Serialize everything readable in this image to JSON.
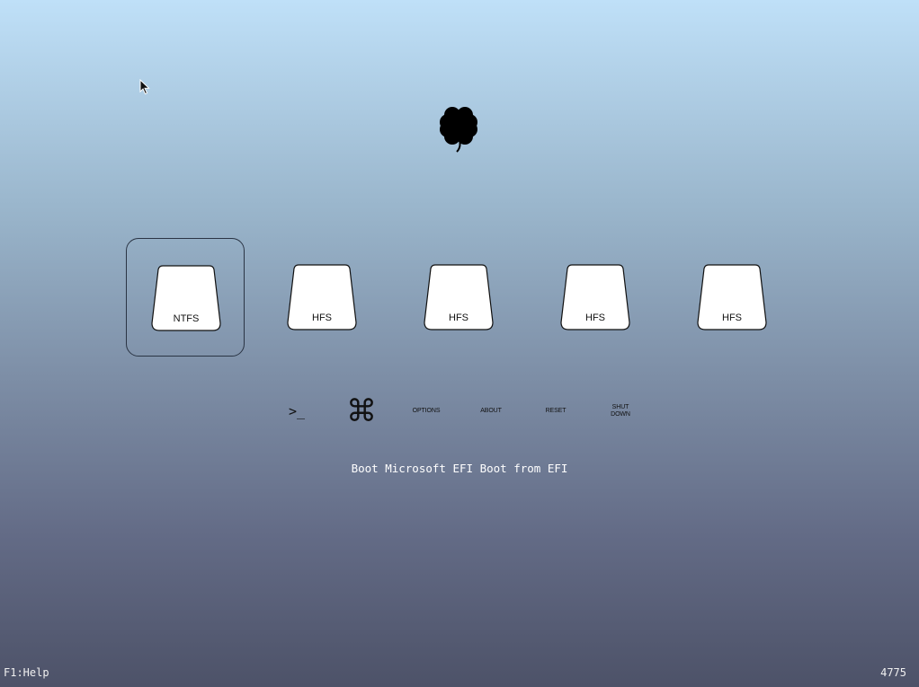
{
  "boot_menu": {
    "logo_icon": "clover-icon",
    "volumes": [
      {
        "label": "NTFS",
        "selected": true
      },
      {
        "label": "HFS",
        "selected": false
      },
      {
        "label": "HFS",
        "selected": false
      },
      {
        "label": "HFS",
        "selected": false
      },
      {
        "label": "HFS",
        "selected": false
      }
    ],
    "tools": [
      {
        "label": ">_",
        "icon": "shell-icon"
      },
      {
        "label": "⌘",
        "icon": "command-icon"
      },
      {
        "label": "OPTIONS"
      },
      {
        "label": "ABOUT"
      },
      {
        "label": "RESET"
      },
      {
        "label": "SHUT DOWN"
      }
    ],
    "status_text": "Boot Microsoft EFI Boot from EFI"
  },
  "footer": {
    "help_text": "F1:Help",
    "counter": "4775"
  },
  "colors": {
    "background_top": "#bfe0f8",
    "background_bottom": "#4d5268",
    "selection_border": "#2a3444",
    "status_text": "#ffffff"
  }
}
